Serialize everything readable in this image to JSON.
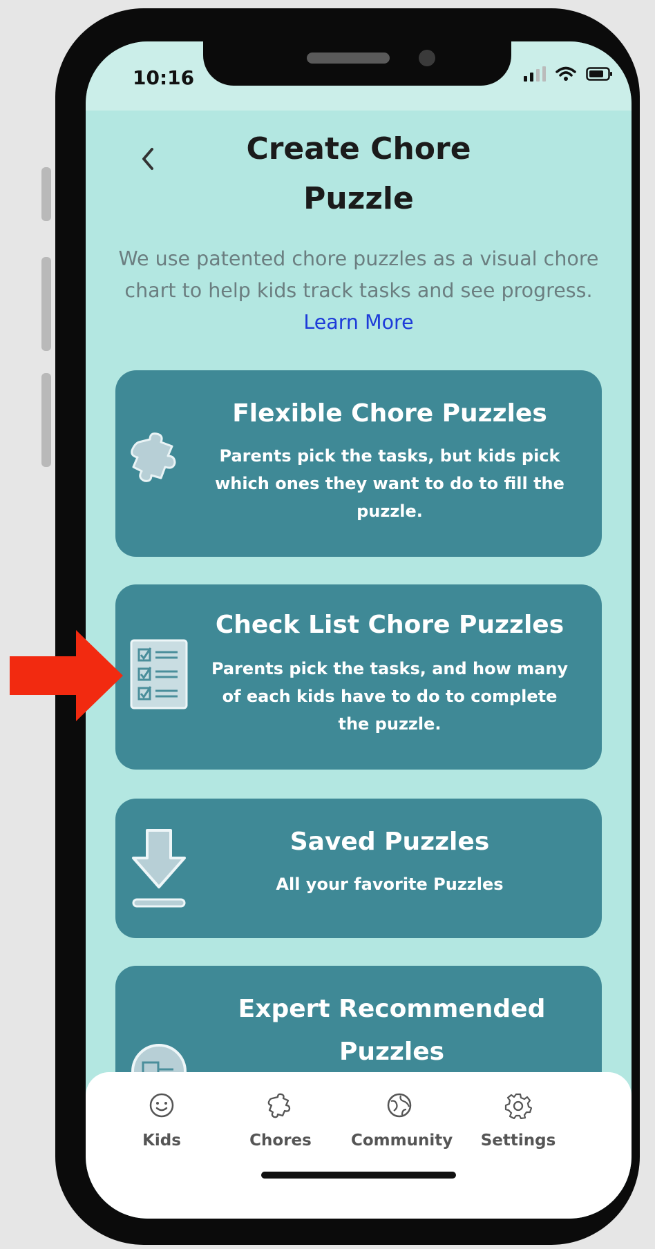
{
  "status_bar": {
    "time": "10:16"
  },
  "header": {
    "title_line1": "Create Chore",
    "title_line2": "Puzzle"
  },
  "intro": {
    "text": "We use patented chore puzzles as a visual chore chart to help kids track tasks and see progress.",
    "link": "Learn More"
  },
  "cards": [
    {
      "icon": "puzzle-piece-icon",
      "title": "Flexible Chore Puzzles",
      "desc": "Parents pick the tasks, but kids pick which ones they want to do to fill the puzzle."
    },
    {
      "icon": "checklist-icon",
      "title": "Check List Chore Puzzles",
      "desc": "Parents pick the tasks, and how many of each kids have to do to complete the puzzle."
    },
    {
      "icon": "download-icon",
      "title": "Saved Puzzles",
      "desc": "All your favorite Puzzles"
    },
    {
      "icon": "puzzle-circle-icon",
      "title": "Expert Recommended Puzzles"
    }
  ],
  "tabs": [
    {
      "label": "Kids",
      "icon": "smiley-icon"
    },
    {
      "label": "Chores",
      "icon": "puzzle-icon"
    },
    {
      "label": "Community",
      "icon": "globe-icon"
    },
    {
      "label": "Settings",
      "icon": "gear-icon"
    }
  ],
  "colors": {
    "background": "#b3e7e1",
    "card": "#3f8996",
    "link": "#1d3bd9",
    "annotation_arrow": "#f22a10"
  }
}
